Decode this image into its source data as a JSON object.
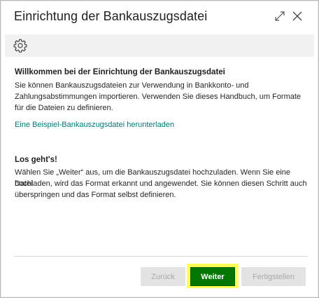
{
  "dialog": {
    "title": "Einrichtung der Bankauszugsdatei",
    "icons": {
      "expand": "expand-icon",
      "close": "close-icon",
      "settings": "gear-icon"
    }
  },
  "welcome": {
    "heading": "Willkommen bei der Einrichtung der Bankauszugsdatei",
    "line1": "Sie können Bankauszugsdateien zur Verwendung in Bankkonto- und",
    "line2": "Zahlungsabstimmungen importieren. Verwenden Sie dieses Handbuch, um Formate",
    "line3": "für die Dateien zu definieren.",
    "link": "Eine Beispiel-Bankauszugsdatei herunterladen"
  },
  "start": {
    "heading": "Los geht's!",
    "line1": "Wählen Sie „Weiter“ aus, um die Bankauszugsdatei hochzuladen. Wenn Sie eine Datei",
    "line2": "hochladen, wird das Format erkannt und angewendet. Sie können diesen Schritt auch",
    "line3": "überspringen und das Format selbst definieren."
  },
  "footer": {
    "back_label": "Zurück",
    "next_label": "Weiter",
    "finish_label": "Fertigstellen"
  },
  "colors": {
    "link": "#00787a",
    "primary_button": "#047604",
    "highlight": "#ffff58"
  }
}
